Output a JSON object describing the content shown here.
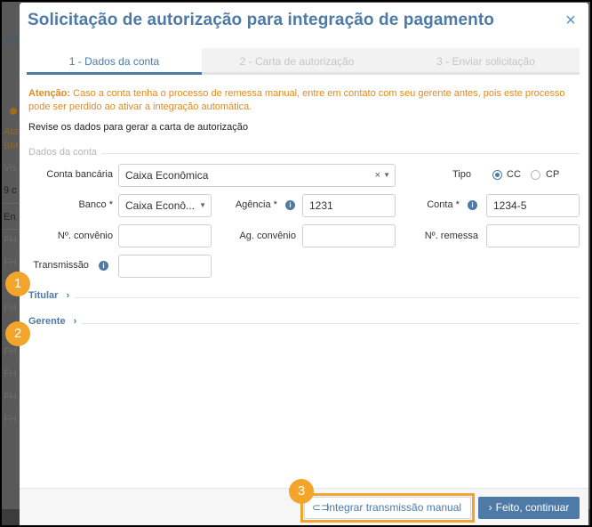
{
  "modal": {
    "title": "Solicitação de autorização para integração de pagamento",
    "close_icon": "×",
    "tabs": [
      {
        "label": "1 - Dados da conta",
        "active": true
      },
      {
        "label": "2 - Carta de autorização",
        "active": false
      },
      {
        "label": "3 - Enviar solicitação",
        "active": false
      }
    ],
    "warning_prefix": "Atenção:",
    "warning_text": "Caso a conta tenha o processo de remessa manual, entre em contato com seu gerente antes, pois este processo pode ser perdido ao ativar a integração automática.",
    "intro": "Revise os dados para gerar a carta de autorização",
    "section_title": "Dados da conta",
    "fields": {
      "conta_bancaria_label": "Conta bancária",
      "conta_bancaria_value": "Caixa Econômica",
      "tipo_label": "Tipo",
      "tipo_options": [
        "CC",
        "CP"
      ],
      "tipo_selected": "CC",
      "banco_label": "Banco *",
      "banco_value": "Caixa Econô...",
      "agencia_label": "Agência *",
      "agencia_value": "1231",
      "conta_label": "Conta *",
      "conta_value": "1234-5",
      "convenio_label": "Nº. convênio",
      "convenio_value": "",
      "ag_convenio_label": "Ag. convênio",
      "ag_convenio_value": "",
      "remessa_label": "Nº. remessa",
      "remessa_value": "",
      "transmissao_label": "Transmissão",
      "transmissao_value": ""
    },
    "collapsibles": [
      {
        "label": "Titular"
      },
      {
        "label": "Gerente"
      }
    ],
    "footer": {
      "manual_button": "Integrar transmissão manual",
      "continue_button": "Feito, continuar"
    }
  },
  "markers": [
    "1",
    "2",
    "3"
  ],
  "background": {
    "title": "In",
    "snippets": [
      "Ata",
      "BM",
      "Vis",
      "9 c",
      "En",
      "FH",
      "FH",
      "FH",
      "FH",
      "FH",
      "FH",
      "FH",
      "FH"
    ]
  },
  "colors": {
    "accent": "#4d7aa6",
    "warning": "#e08a1e",
    "marker": "#f3a52b"
  },
  "icons": {
    "info": "info-circle-icon",
    "link": "link-icon",
    "chevron": "chevron-right-icon"
  }
}
